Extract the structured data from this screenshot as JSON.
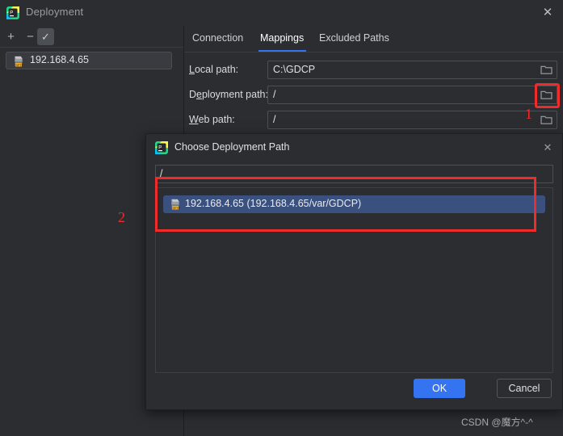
{
  "window": {
    "title": "Deployment",
    "icon": "pycharm-icon",
    "close_label": "✕"
  },
  "sidebar": {
    "toolbar": {
      "add_label": "+",
      "remove_label": "−",
      "default_label": "✓"
    },
    "servers": [
      {
        "label": "192.168.4.65",
        "icon": "sftp-server-icon"
      }
    ]
  },
  "main": {
    "tabs": [
      {
        "label": "Connection",
        "active": false
      },
      {
        "label": "Mappings",
        "active": true
      },
      {
        "label": "Excluded Paths",
        "active": false
      }
    ],
    "fields": [
      {
        "label_pre": "",
        "label_mnemonic": "L",
        "label_post": "ocal path:",
        "value": "C:\\GDCP",
        "browse_icon": "folder-icon"
      },
      {
        "label_pre": "D",
        "label_mnemonic": "e",
        "label_post": "ployment path:",
        "value": "/",
        "browse_icon": "folder-icon"
      },
      {
        "label_pre": "",
        "label_mnemonic": "W",
        "label_post": "eb path:",
        "value": "/",
        "browse_icon": "folder-icon"
      }
    ]
  },
  "dialog": {
    "title": "Choose Deployment Path",
    "icon": "pycharm-icon",
    "close_label": "✕",
    "path_input": {
      "value": "/",
      "placeholder": ""
    },
    "tree": [
      {
        "label": "192.168.4.65 (192.168.4.65/var/GDCP)",
        "icon": "sftp-server-icon",
        "selected": true
      }
    ],
    "buttons": {
      "ok_label": "OK",
      "cancel_label": "Cancel"
    }
  },
  "annotations": [
    {
      "id": "1",
      "label": "1",
      "target": "deployment-path-browse-button"
    },
    {
      "id": "2",
      "label": "2",
      "target": "dialog-tree-selection"
    }
  ],
  "watermark": {
    "text": "CSDN @魔方^-^"
  },
  "colors": {
    "accent_blue": "#3574f0",
    "annotation_red": "#ef2b2b",
    "selection_blue": "#3a5180",
    "panel_bg": "#2b2d30",
    "border": "#4c5055"
  }
}
